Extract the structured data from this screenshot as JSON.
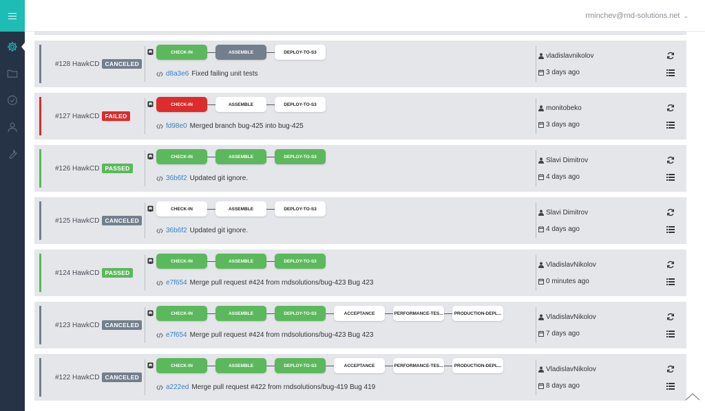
{
  "app": {
    "accent": "#1ebcb4",
    "sidebar_bg": "#263347"
  },
  "header": {
    "user": "rminchev@rnd-solutions.net"
  },
  "sidebar": {
    "items": [
      {
        "icon": "gear-icon",
        "active": true
      },
      {
        "icon": "folder-icon",
        "active": false
      },
      {
        "icon": "check-circle-icon",
        "active": false
      },
      {
        "icon": "user-icon",
        "active": false
      },
      {
        "icon": "wrench-icon",
        "active": false
      }
    ]
  },
  "colors": {
    "passed": "#5cb85c",
    "failed": "#dd2c2c",
    "canceled": "#737f8c",
    "not_run": "#ffffff"
  },
  "builds": [
    {
      "id": "#128 HawkCD",
      "status": "CANCELED",
      "stages": [
        {
          "name": "CHECK-IN",
          "state": "passed"
        },
        {
          "name": "ASSEMBLE",
          "state": "canceled"
        },
        {
          "name": "DEPLOY-TO-S3",
          "state": "not_run"
        }
      ],
      "hash": "d8a3e6",
      "message": "Fixed failing unit tests",
      "author": "vladislavnikolov",
      "time": "3 days ago"
    },
    {
      "id": "#127 HawkCD",
      "status": "FAILED",
      "stages": [
        {
          "name": "CHECK-IN",
          "state": "failed"
        },
        {
          "name": "ASSEMBLE",
          "state": "not_run"
        },
        {
          "name": "DEPLOY-TO-S3",
          "state": "not_run"
        }
      ],
      "hash": "fd98e0",
      "message": "Merged branch bug-425 into bug-425",
      "author": "monitobeko",
      "time": "3 days ago"
    },
    {
      "id": "#126 HawkCD",
      "status": "PASSED",
      "stages": [
        {
          "name": "CHECK-IN",
          "state": "passed"
        },
        {
          "name": "ASSEMBLE",
          "state": "passed"
        },
        {
          "name": "DEPLOY-TO-S3",
          "state": "passed"
        }
      ],
      "hash": "36b6f2",
      "message": "Updated git ignore.",
      "author": "Slavi Dimitrov",
      "time": "4 days ago"
    },
    {
      "id": "#125 HawkCD",
      "status": "CANCELED",
      "stages": [
        {
          "name": "CHECK-IN",
          "state": "not_run"
        },
        {
          "name": "ASSEMBLE",
          "state": "not_run"
        },
        {
          "name": "DEPLOY-TO-S3",
          "state": "not_run"
        }
      ],
      "hash": "36b6f2",
      "message": "Updated git ignore.",
      "author": "Slavi Dimitrov",
      "time": "4 days ago"
    },
    {
      "id": "#124 HawkCD",
      "status": "PASSED",
      "stages": [
        {
          "name": "CHECK-IN",
          "state": "passed"
        },
        {
          "name": "ASSEMBLE",
          "state": "passed"
        },
        {
          "name": "DEPLOY-TO-S3",
          "state": "passed"
        }
      ],
      "hash": "e7f654",
      "message": "Merge pull request #424 from rndsolutions/bug-423 Bug 423",
      "author": "VladislavNikolov",
      "time": "0 minutes ago"
    },
    {
      "id": "#123 HawkCD",
      "status": "CANCELED",
      "stages": [
        {
          "name": "CHECK-IN",
          "state": "passed"
        },
        {
          "name": "ASSEMBLE",
          "state": "passed"
        },
        {
          "name": "DEPLOY-TO-S3",
          "state": "passed"
        },
        {
          "name": "ACCEPTANCE",
          "state": "not_run"
        },
        {
          "name": "PERFORMANCE-TES...",
          "state": "not_run"
        },
        {
          "name": "PRODUCTION-DEPL...",
          "state": "not_run"
        }
      ],
      "hash": "e7f654",
      "message": "Merge pull request #424 from rndsolutions/bug-423 Bug 423",
      "author": "VladislavNikolov",
      "time": "7 days ago"
    },
    {
      "id": "#122 HawkCD",
      "status": "CANCELED",
      "stages": [
        {
          "name": "CHECK-IN",
          "state": "passed"
        },
        {
          "name": "ASSEMBLE",
          "state": "passed"
        },
        {
          "name": "DEPLOY-TO-S3",
          "state": "passed"
        },
        {
          "name": "ACCEPTANCE",
          "state": "not_run"
        },
        {
          "name": "PERFORMANCE-TES...",
          "state": "not_run"
        },
        {
          "name": "PRODUCTION-DEPL...",
          "state": "not_run"
        }
      ],
      "hash": "a222ed",
      "message": "Merge pull request #422 from rndsolutions/bug-419 Bug 419",
      "author": "VladislavNikolov",
      "time": "8 days ago"
    }
  ]
}
